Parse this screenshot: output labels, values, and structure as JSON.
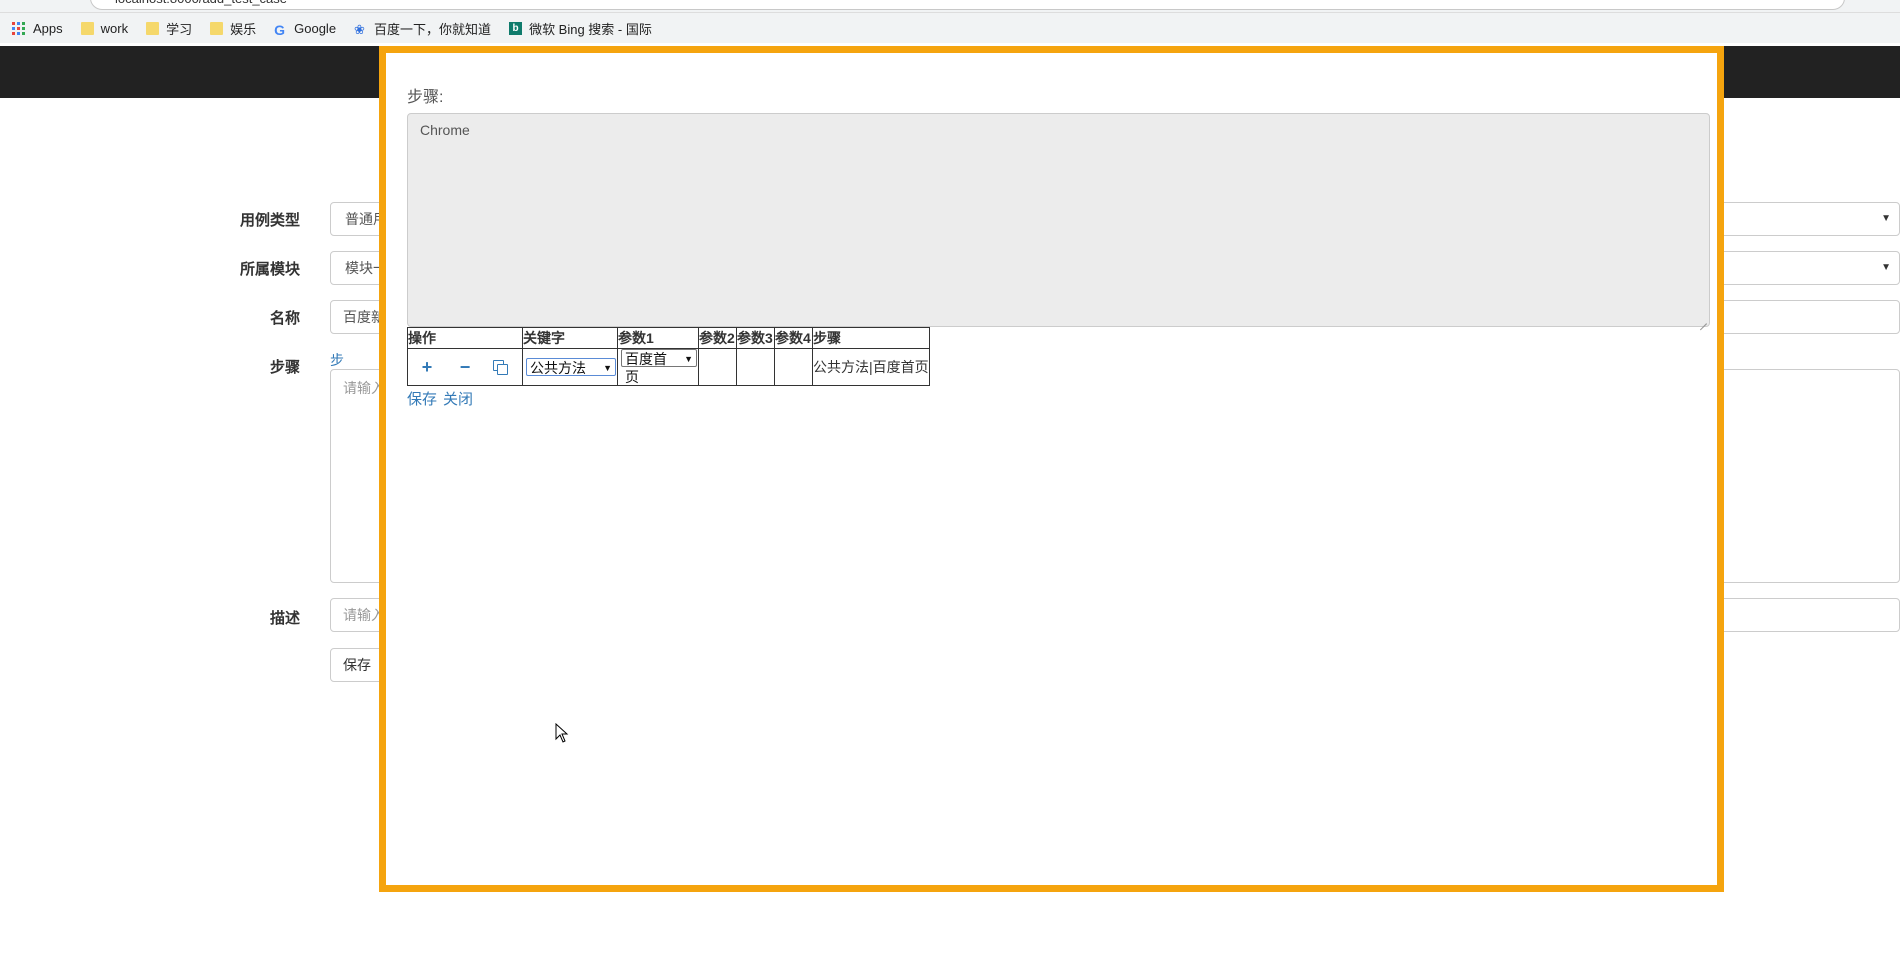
{
  "browser": {
    "url": "localhost:8000/add_test_case",
    "bookmarks": [
      {
        "icon": "apps-icon",
        "label": "Apps"
      },
      {
        "icon": "folder-icon",
        "label": "work"
      },
      {
        "icon": "folder-icon",
        "label": "学习"
      },
      {
        "icon": "folder-icon",
        "label": "娱乐"
      },
      {
        "icon": "google-icon",
        "label": "Google"
      },
      {
        "icon": "baidu-icon",
        "label": "百度一下，你就知道"
      },
      {
        "icon": "bing-icon",
        "label": "微软 Bing 搜索 - 国际"
      }
    ]
  },
  "form": {
    "case_type_label": "用例类型",
    "case_type_value": "普通用例",
    "module_label": "所属模块",
    "module_value": "模块一",
    "name_label": "名称",
    "name_value": "百度新闻",
    "steps_label": "步骤",
    "steps_generate_link": "步骤生成",
    "steps_placeholder": "请输入",
    "desc_label": "描述",
    "desc_placeholder": "请输入",
    "save_button": "保存"
  },
  "modal": {
    "title": "步骤:",
    "textarea_value": "Chrome",
    "table": {
      "headers": [
        "操作",
        "关键字",
        "参数1",
        "参数2",
        "参数3",
        "参数4",
        "步骤"
      ],
      "row": {
        "add": "+",
        "remove": "−",
        "keyword": "公共方法",
        "param1": "百度首页",
        "param2": "",
        "param3": "",
        "param4": "",
        "step": "公共方法|百度首页"
      }
    },
    "save_link": "保存",
    "close_link": "关闭"
  },
  "colors": {
    "modal_border": "#f5a40e",
    "navbar": "#222222",
    "link": "#337ab7"
  }
}
